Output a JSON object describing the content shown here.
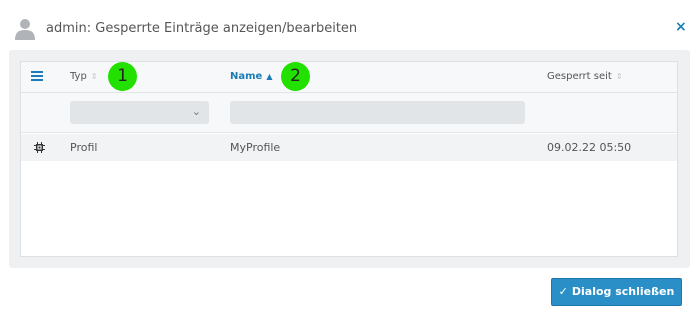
{
  "dialog": {
    "title": "admin: Gesperrte Einträge anzeigen/bearbeiten",
    "close_glyph": "×"
  },
  "grid": {
    "columns": [
      {
        "label": "Typ",
        "sort": "none"
      },
      {
        "label": "Name",
        "sort": "ascending"
      },
      {
        "label": "Gesperrt seit",
        "sort": "none"
      }
    ],
    "filters": {
      "typ_value": "",
      "name_value": ""
    },
    "rows": [
      {
        "icon": "chip-icon",
        "typ": "Profil",
        "name": "MyProfile",
        "gesperrt_seit": "09.02.22 05:50"
      }
    ]
  },
  "markers": [
    "1",
    "2"
  ],
  "footer": {
    "close_button_label": "Dialog schließen"
  },
  "icons": {
    "title": "user-icon",
    "menu": "menu-icon",
    "close": "close-icon",
    "button": "check-icon"
  },
  "colors": {
    "accent": "#1a7db5",
    "button": "#2a8fc7",
    "marker": "#22e000"
  }
}
